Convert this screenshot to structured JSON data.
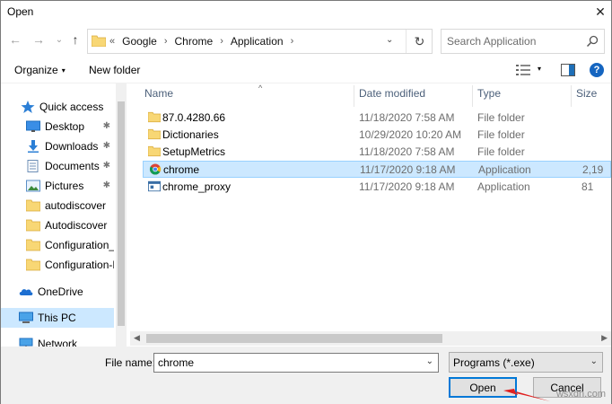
{
  "window": {
    "title": "Open",
    "close_glyph": "✕"
  },
  "nav": {
    "back_glyph": "←",
    "forward_glyph": "→",
    "recent_glyph": "⌄",
    "up_glyph": "↑",
    "breadcrumb_prefix": "«",
    "breadcrumbs": [
      "Google",
      "Chrome",
      "Application"
    ],
    "crumb_separator": "›",
    "dropdown_glyph": "⌄",
    "refresh_glyph": "↻"
  },
  "search": {
    "placeholder": "Search Application"
  },
  "toolbar": {
    "organize_label": "Organize",
    "organize_caret": "▾",
    "new_folder_label": "New folder",
    "view_caret": "▾",
    "help_glyph": "?"
  },
  "sidebar": {
    "items": [
      {
        "label": "Quick access",
        "icon": "star-icon",
        "pinned": false
      },
      {
        "label": "Desktop",
        "icon": "desktop-icon",
        "pinned": true
      },
      {
        "label": "Downloads",
        "icon": "download-icon",
        "pinned": true
      },
      {
        "label": "Documents",
        "icon": "documents-icon",
        "pinned": true
      },
      {
        "label": "Pictures",
        "icon": "pictures-icon",
        "pinned": true
      },
      {
        "label": "autodiscover",
        "icon": "folder-icon",
        "pinned": false
      },
      {
        "label": "Autodiscover",
        "icon": "folder-icon",
        "pinned": false
      },
      {
        "label": "Configuration_lc",
        "icon": "folder-icon",
        "pinned": false
      },
      {
        "label": "Configuration-E",
        "icon": "folder-icon",
        "pinned": false
      },
      {
        "label": "OneDrive",
        "icon": "cloud-icon",
        "pinned": false
      },
      {
        "label": "This PC",
        "icon": "computer-icon",
        "pinned": false
      },
      {
        "label": "Network",
        "icon": "network-icon",
        "pinned": false
      }
    ],
    "pin_glyph": "📌"
  },
  "columns": {
    "name": "Name",
    "date": "Date modified",
    "type": "Type",
    "size": "Size",
    "sort_glyph": "^"
  },
  "files": [
    {
      "name": "87.0.4280.66",
      "date": "11/18/2020 7:58 AM",
      "type": "File folder",
      "size": "",
      "icon": "folder-icon"
    },
    {
      "name": "Dictionaries",
      "date": "10/29/2020 10:20 AM",
      "type": "File folder",
      "size": "",
      "icon": "folder-icon"
    },
    {
      "name": "SetupMetrics",
      "date": "11/18/2020 7:58 AM",
      "type": "File folder",
      "size": "",
      "icon": "folder-icon"
    },
    {
      "name": "chrome",
      "date": "11/17/2020 9:18 AM",
      "type": "Application",
      "size": "2,19",
      "icon": "chrome-icon",
      "selected": true
    },
    {
      "name": "chrome_proxy",
      "date": "11/17/2020 9:18 AM",
      "type": "Application",
      "size": "81",
      "icon": "app-icon"
    }
  ],
  "scroll": {
    "left_glyph": "◀",
    "right_glyph": "▶"
  },
  "bottom": {
    "file_name_label": "File name:",
    "file_name_value": "chrome",
    "filter_value": "Programs (*.exe)",
    "dropdown_glyph": "⌄",
    "open_label": "Open",
    "cancel_label": "Cancel"
  },
  "watermark": "wsxdn.com",
  "colors": {
    "selection": "#cce8ff",
    "accent": "#0078d7",
    "folder": "#f8d775",
    "arrow": "#e02020"
  }
}
